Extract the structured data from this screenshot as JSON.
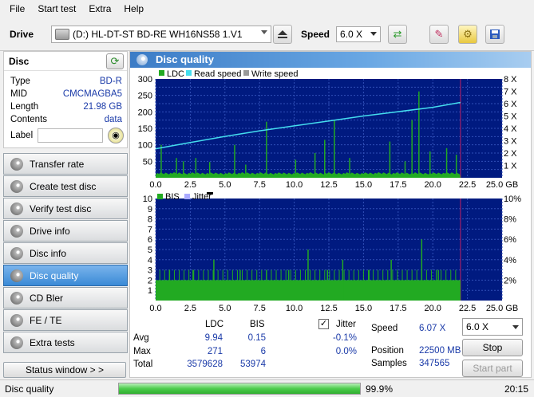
{
  "menu": [
    "File",
    "Start test",
    "Extra",
    "Help"
  ],
  "toolbar": {
    "drive_label": "Drive",
    "drive_value": "(D:)  HL-DT-ST BD-RE  WH16NS58 1.V1",
    "speed_label": "Speed",
    "speed_value": "6.0 X"
  },
  "disc": {
    "title": "Disc",
    "rows": [
      {
        "key": "Type",
        "value": "BD-R"
      },
      {
        "key": "MID",
        "value": "CMCMAGBA5"
      },
      {
        "key": "Length",
        "value": "21.98 GB"
      },
      {
        "key": "Contents",
        "value": "data"
      }
    ],
    "label_key": "Label",
    "label_value": ""
  },
  "nav": [
    {
      "label": "Transfer rate",
      "active": false
    },
    {
      "label": "Create test disc",
      "active": false
    },
    {
      "label": "Verify test disc",
      "active": false
    },
    {
      "label": "Drive info",
      "active": false
    },
    {
      "label": "Disc info",
      "active": false
    },
    {
      "label": "Disc quality",
      "active": true
    },
    {
      "label": "CD Bler",
      "active": false
    },
    {
      "label": "FE / TE",
      "active": false
    },
    {
      "label": "Extra tests",
      "active": false
    }
  ],
  "status_window_label": "Status window > >",
  "panel_title": "Disc quality",
  "chart_data": [
    {
      "type": "bar",
      "legend": [
        "LDC",
        "Read speed",
        "Write speed"
      ],
      "colors": {
        "LDC": "#22aa22",
        "Read speed": "#44ddee",
        "Write speed": "#999999",
        "background": "#001a80"
      },
      "x_ticks": [
        "0.0",
        "2.5",
        "5.0",
        "7.5",
        "10.0",
        "12.5",
        "15.0",
        "17.5",
        "20.0",
        "22.5",
        "25.0 GB"
      ],
      "y_left_ticks": [
        "50",
        "100",
        "150",
        "200",
        "250",
        "300"
      ],
      "y_right_ticks": [
        "1 X",
        "2 X",
        "3 X",
        "4 X",
        "5 X",
        "6 X",
        "7 X",
        "8 X"
      ],
      "xlim": [
        0,
        25
      ],
      "ylim": [
        0,
        300
      ],
      "y2lim": [
        0,
        8
      ],
      "disc_end_gb": 22.0,
      "read_speed": {
        "x": [
          0,
          2.5,
          5,
          7.5,
          10,
          12.5,
          15,
          17.5,
          20,
          22
        ],
        "y": [
          2.35,
          2.85,
          3.35,
          3.8,
          4.2,
          4.6,
          5.0,
          5.35,
          5.7,
          6.1
        ]
      },
      "ldc_baseline": 12,
      "ldc_spikes": [
        {
          "x": 0.4,
          "y": 100
        },
        {
          "x": 1.5,
          "y": 60
        },
        {
          "x": 2.0,
          "y": 50
        },
        {
          "x": 2.9,
          "y": 60
        },
        {
          "x": 3.9,
          "y": 48
        },
        {
          "x": 5.7,
          "y": 100
        },
        {
          "x": 6.5,
          "y": 40
        },
        {
          "x": 8.0,
          "y": 170
        },
        {
          "x": 10.1,
          "y": 55
        },
        {
          "x": 11.5,
          "y": 75
        },
        {
          "x": 12.2,
          "y": 115
        },
        {
          "x": 12.9,
          "y": 175
        },
        {
          "x": 14.0,
          "y": 60
        },
        {
          "x": 16.9,
          "y": 110
        },
        {
          "x": 18.0,
          "y": 50
        },
        {
          "x": 18.5,
          "y": 175
        },
        {
          "x": 19.0,
          "y": 262
        },
        {
          "x": 19.8,
          "y": 80
        },
        {
          "x": 21.0,
          "y": 90
        },
        {
          "x": 21.7,
          "y": 70
        }
      ]
    },
    {
      "type": "bar",
      "legend": [
        "BIS",
        "Jitter"
      ],
      "colors": {
        "BIS": "#22aa22",
        "Jitter": "#aaaaff",
        "background": "#001a80"
      },
      "x_ticks": [
        "0.0",
        "2.5",
        "5.0",
        "7.5",
        "10.0",
        "12.5",
        "15.0",
        "17.5",
        "20.0",
        "22.5",
        "25.0 GB"
      ],
      "y_left_ticks": [
        "1",
        "2",
        "3",
        "4",
        "5",
        "6",
        "7",
        "8",
        "9",
        "10"
      ],
      "y_right_ticks": [
        "2%",
        "4%",
        "6%",
        "8%",
        "10%"
      ],
      "xlim": [
        0,
        25
      ],
      "ylim": [
        0,
        10
      ],
      "y2lim": [
        0,
        10
      ],
      "disc_end_gb": 22.0,
      "bis_baseline": 2,
      "bis_spikes": [
        {
          "x": 1.0,
          "y": 3
        },
        {
          "x": 2.7,
          "y": 3
        },
        {
          "x": 4.2,
          "y": 4
        },
        {
          "x": 6.1,
          "y": 3
        },
        {
          "x": 8.0,
          "y": 3
        },
        {
          "x": 9.6,
          "y": 3
        },
        {
          "x": 11.0,
          "y": 5
        },
        {
          "x": 12.4,
          "y": 3
        },
        {
          "x": 13.5,
          "y": 4
        },
        {
          "x": 15.4,
          "y": 3
        },
        {
          "x": 17.0,
          "y": 4
        },
        {
          "x": 19.2,
          "y": 6
        },
        {
          "x": 20.4,
          "y": 3
        }
      ]
    }
  ],
  "stats": {
    "col_ldc": "LDC",
    "col_bis": "BIS",
    "jitter_label": "Jitter",
    "jitter_checked": true,
    "rows": [
      {
        "label": "Avg",
        "ldc": "9.94",
        "bis": "0.15",
        "jitter": "-0.1%"
      },
      {
        "label": "Max",
        "ldc": "271",
        "bis": "6",
        "jitter": "0.0%"
      },
      {
        "label": "Total",
        "ldc": "3579628",
        "bis": "53974",
        "jitter": ""
      }
    ],
    "speed_label": "Speed",
    "speed_value": "6.07 X",
    "position_label": "Position",
    "position_value": "22500 MB",
    "samples_label": "Samples",
    "samples_value": "347565",
    "speed_select": "6.0 X",
    "stop_label": "Stop",
    "start_part_label": "Start part"
  },
  "statusbar": {
    "text": "Disc quality",
    "progress": 0.999,
    "progress_text": "99.9%",
    "time": "20:15"
  }
}
